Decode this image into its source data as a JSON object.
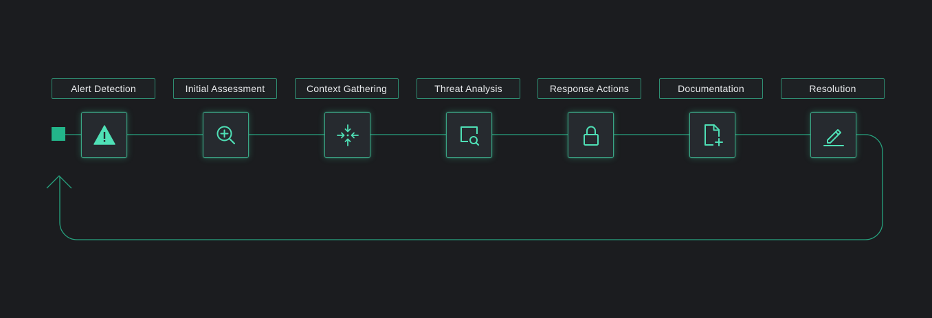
{
  "colors": {
    "background": "#1b1c1f",
    "accent": "#4fe0b6",
    "line": "#27a37f",
    "label_border": "#2f8f73",
    "box_fill": "#262a2f",
    "start_node": "#23b58a"
  },
  "steps": [
    {
      "label": "Alert Detection",
      "icon": "warning-triangle-icon"
    },
    {
      "label": "Initial Assessment",
      "icon": "zoom-in-icon"
    },
    {
      "label": "Context Gathering",
      "icon": "collapse-arrows-icon"
    },
    {
      "label": "Threat Analysis",
      "icon": "screen-search-icon"
    },
    {
      "label": "Response Actions",
      "icon": "padlock-icon"
    },
    {
      "label": "Documentation",
      "icon": "file-add-icon"
    },
    {
      "label": "Resolution",
      "icon": "pencil-edit-icon"
    }
  ]
}
